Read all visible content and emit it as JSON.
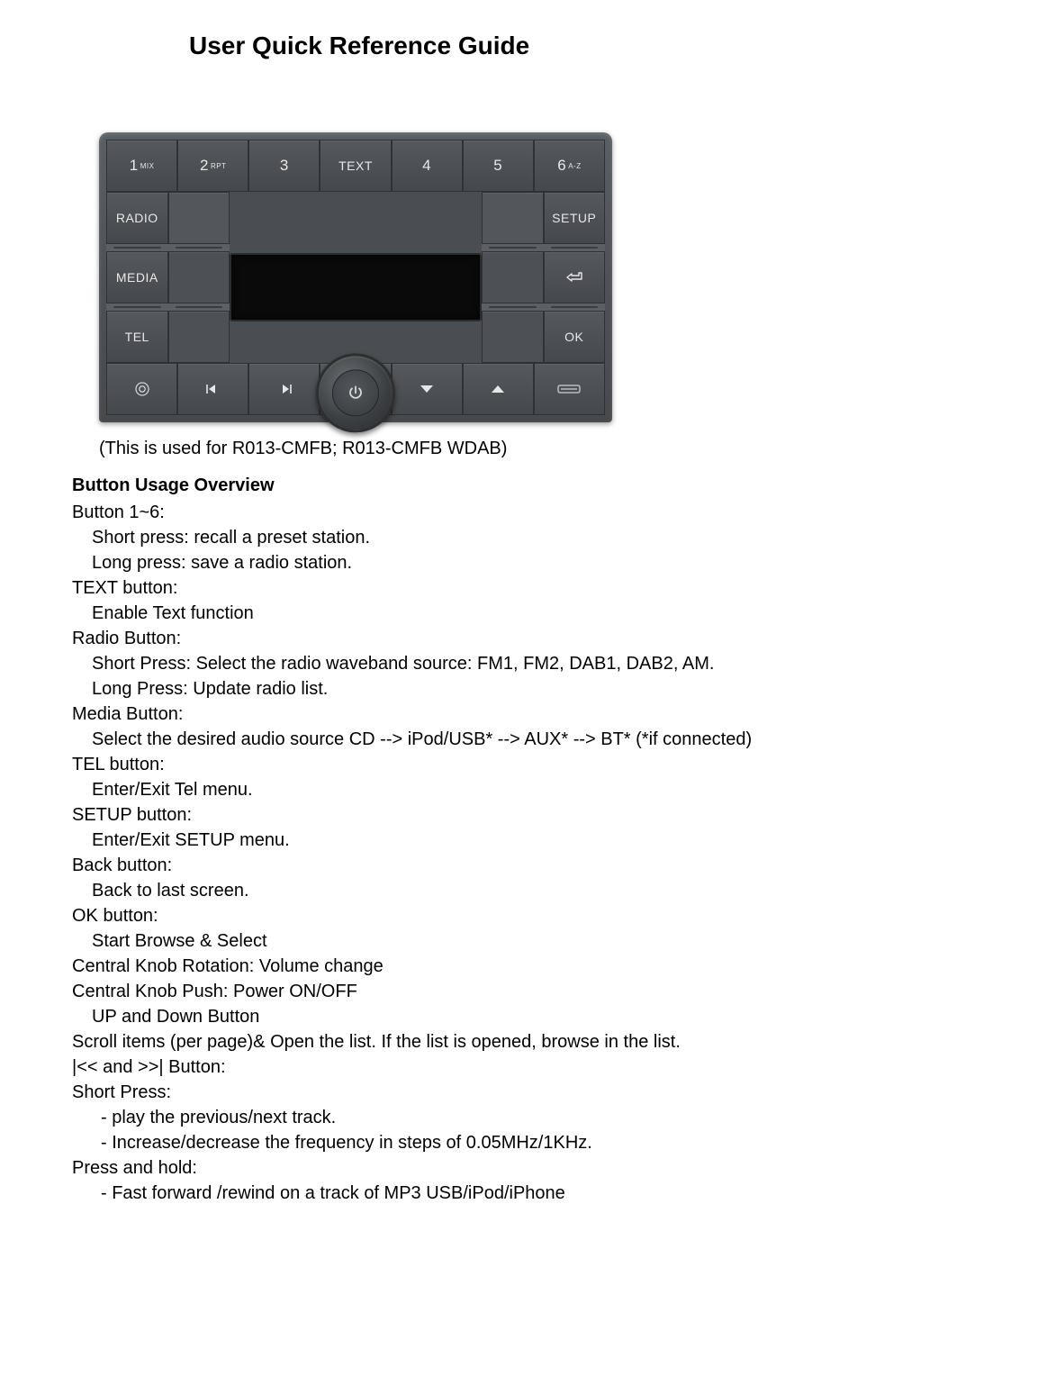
{
  "title": "User Quick Reference Guide",
  "panel": {
    "row1": {
      "b1": {
        "num": "1",
        "sub": "MIX"
      },
      "b2": {
        "num": "2",
        "sub": "RPT"
      },
      "b3": {
        "num": "3",
        "sub": ""
      },
      "text": "TEXT",
      "b4": {
        "num": "4",
        "sub": ""
      },
      "b5": {
        "num": "5",
        "sub": ""
      },
      "b6": {
        "num": "6",
        "sub": "A-Z"
      }
    },
    "left": {
      "radio": "RADIO",
      "media": "MEDIA",
      "tel": "TEL"
    },
    "right": {
      "setup": "SETUP",
      "ok": "OK"
    }
  },
  "caption": "(This is used for R013-CMFB; R013-CMFB WDAB)",
  "section_title": "Button Usage Overview",
  "lines": {
    "l01": "Button 1~6:",
    "l02": "Short press: recall a preset station.",
    "l03": "Long press: save a radio station.",
    "l04": "TEXT button:",
    "l05": "Enable Text function",
    "l06": "Radio Button:",
    "l07": "Short Press: Select the radio waveband source: FM1, FM2, DAB1, DAB2, AM.",
    "l08": "Long Press: Update radio list.",
    "l09": "Media Button:",
    "l10": "Select the desired audio source CD --> iPod/USB* --> AUX* --> BT* (*if connected)",
    "l11": "TEL button:",
    "l12": "Enter/Exit Tel menu.",
    "l13": "SETUP button:",
    "l14": "Enter/Exit SETUP menu.",
    "l15": "Back button:",
    "l16": "Back to last screen.",
    "l17": "OK button:",
    "l18": "Start Browse & Select",
    "l19": "Central Knob Rotation: Volume change",
    "l20": "Central Knob Push: Power ON/OFF",
    "l21": "UP and Down Button",
    "l22": "Scroll items (per page)& Open the list. If the list is opened, browse in the list.",
    "l23": "|<< and >>| Button:",
    "l24": "Short Press:",
    "l25": "- play the previous/next track.",
    "l26": "- Increase/decrease the frequency in steps of 0.05MHz/1KHz.",
    "l27": "Press and hold:",
    "l28": "- Fast forward /rewind on a track of MP3 USB/iPod/iPhone"
  }
}
